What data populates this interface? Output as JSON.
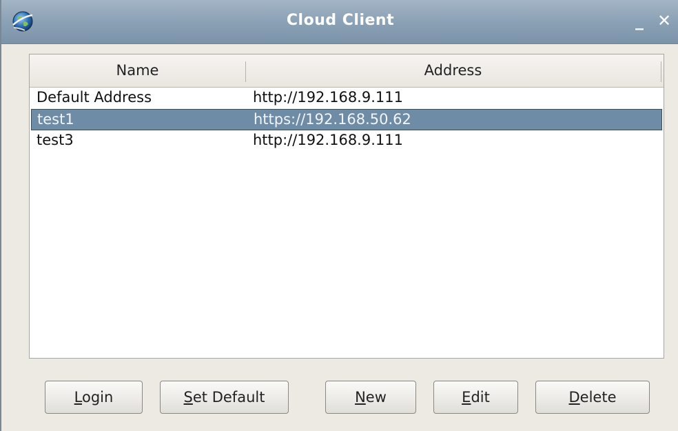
{
  "window": {
    "title": "Cloud Client",
    "minimize_glyph": "_",
    "close_glyph": "✕"
  },
  "icons": {
    "app": "globe-icon",
    "minimize": "minimize-icon",
    "close": "close-icon"
  },
  "list": {
    "columns": [
      "Name",
      "Address"
    ],
    "rows": [
      {
        "name": "Default Address",
        "address": "http://192.168.9.111",
        "selected": false
      },
      {
        "name": "test1",
        "address": "https://192.168.50.62",
        "selected": true
      },
      {
        "name": "test3",
        "address": "http://192.168.9.111",
        "selected": false
      }
    ]
  },
  "buttons": {
    "login": {
      "mnemonic": "L",
      "rest": "ogin"
    },
    "set_default": {
      "mnemonic": "S",
      "rest": "et Default"
    },
    "new": {
      "mnemonic": "N",
      "rest": "ew"
    },
    "edit": {
      "mnemonic": "E",
      "rest": "dit"
    },
    "delete": {
      "mnemonic": "D",
      "rest": "elete"
    }
  },
  "colors": {
    "selection": "#6f8ca7",
    "titlebar": "#8ba1b5",
    "window_bg": "#edeae4"
  }
}
